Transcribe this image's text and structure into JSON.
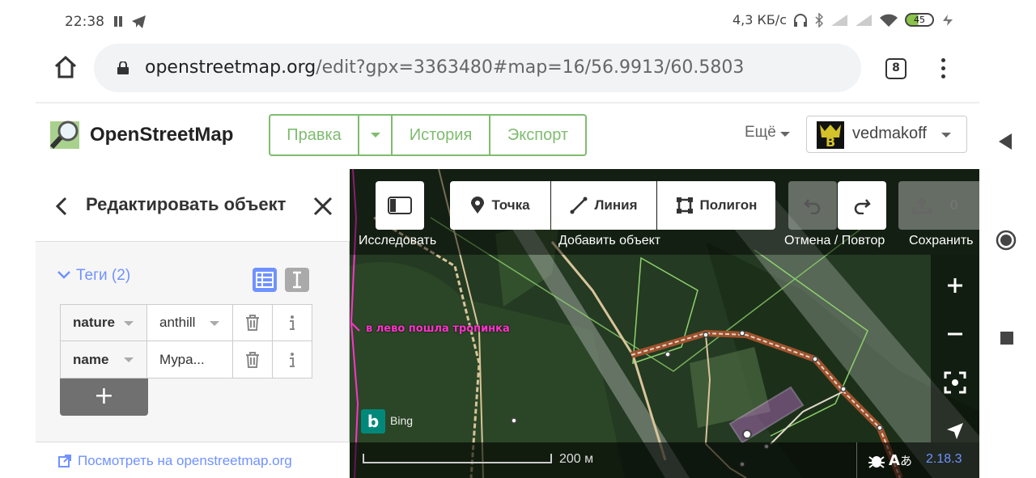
{
  "status_bar": {
    "time": "22:38",
    "network_speed": "4,3 КБ/с",
    "battery": "45"
  },
  "browser": {
    "url_host": "openstreetmap.org",
    "url_path": "/edit?gpx=3363480#map=16/56.9913/60.5803",
    "tab_count": "8"
  },
  "osm_header": {
    "brand": "OpenStreetMap",
    "edit_label": "Правка",
    "history_label": "История",
    "export_label": "Экспорт",
    "more_label": "Ещё",
    "username": "vedmakoff"
  },
  "sidebar": {
    "title": "Редактировать объект",
    "tags_header": "Теги (2)",
    "tags": [
      {
        "key": "nature",
        "value": "anthill"
      },
      {
        "key": "name",
        "value": "Мура..."
      }
    ],
    "add_label": "+",
    "view_link": "Посмотреть на openstreetmap.org"
  },
  "map": {
    "toolbar": {
      "point_label": "Точка",
      "line_label": "Линия",
      "polygon_label": "Полигон",
      "explore_caption": "Исследовать",
      "add_caption": "Добавить объект",
      "undo_caption": "Отмена / Повтор",
      "save_caption": "Сохранить",
      "save_count": "0"
    },
    "feature_label": "в лево пошла тропинка",
    "imagery": "Bing",
    "scale_text": "200 м",
    "version": "2.18.3",
    "colors": {
      "accent_green": "#7ebc6f",
      "link_blue": "#7092ff",
      "track_magenta": "#ff33cc",
      "path_brown": "#a0522d"
    }
  }
}
